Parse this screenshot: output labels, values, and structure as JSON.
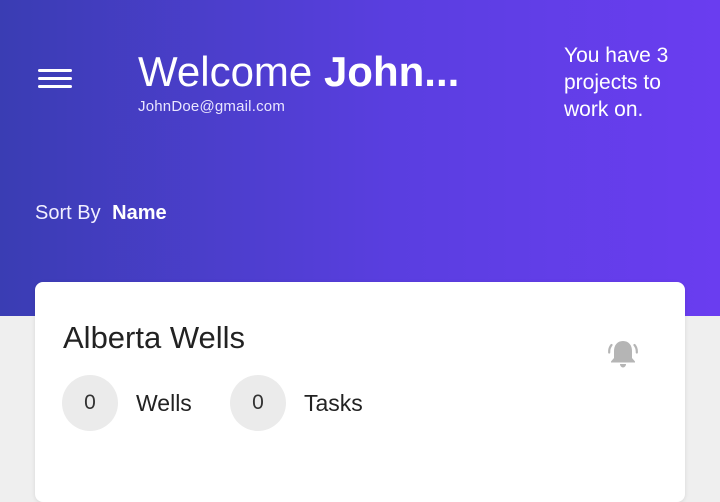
{
  "header": {
    "greeting": "Welcome",
    "user_name": "John...",
    "email": "JohnDoe@gmail.com",
    "projects_message": "You have 3 projects to work on."
  },
  "sort": {
    "label": "Sort By",
    "value": "Name"
  },
  "projects": [
    {
      "name": "Alberta Wells",
      "wells_count": "0",
      "wells_label": "Wells",
      "tasks_count": "0",
      "tasks_label": "Tasks"
    }
  ],
  "icons": {
    "menu": "hamburger-menu-icon",
    "notification": "bell-icon"
  },
  "colors": {
    "header_gradient_start": "#3a3db3",
    "header_gradient_end": "#6a3df0",
    "page_background": "#efefef",
    "card_background": "#ffffff",
    "badge_background": "#ebebeb",
    "bell_color": "#b5b5b5"
  }
}
